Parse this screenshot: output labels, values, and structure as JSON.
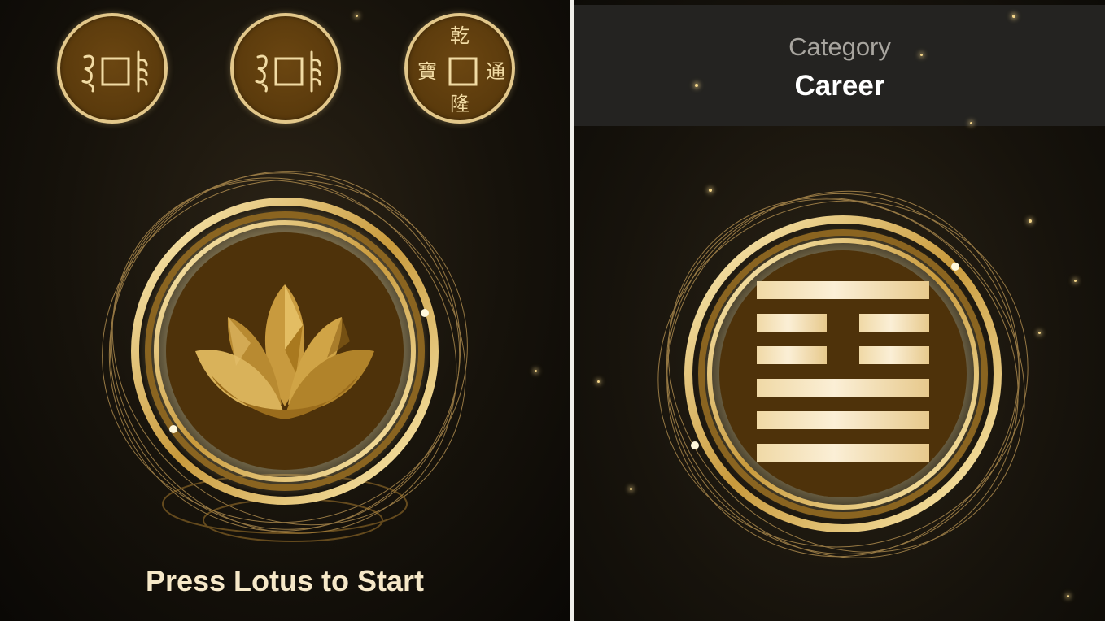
{
  "left_screen": {
    "coins": [
      {
        "type": "manchu"
      },
      {
        "type": "manchu"
      },
      {
        "type": "chinese",
        "chars": {
          "top": "乾",
          "bottom": "隆",
          "left": "寶",
          "right": "通"
        }
      }
    ],
    "lotus_button": {
      "icon": "lotus-icon"
    },
    "instruction": "Press Lotus to Start"
  },
  "right_screen": {
    "category": {
      "label": "Category",
      "value": "Career"
    },
    "hexagram": {
      "icon": "hexagram-icon",
      "lines_top_to_bottom": [
        "solid",
        "broken",
        "broken",
        "solid",
        "solid",
        "solid"
      ]
    }
  },
  "colors": {
    "gold": "#e2c78a",
    "coin_brown": "#5a3a0c",
    "header_bg": "#242321",
    "text_cream": "#f6e8c8"
  }
}
